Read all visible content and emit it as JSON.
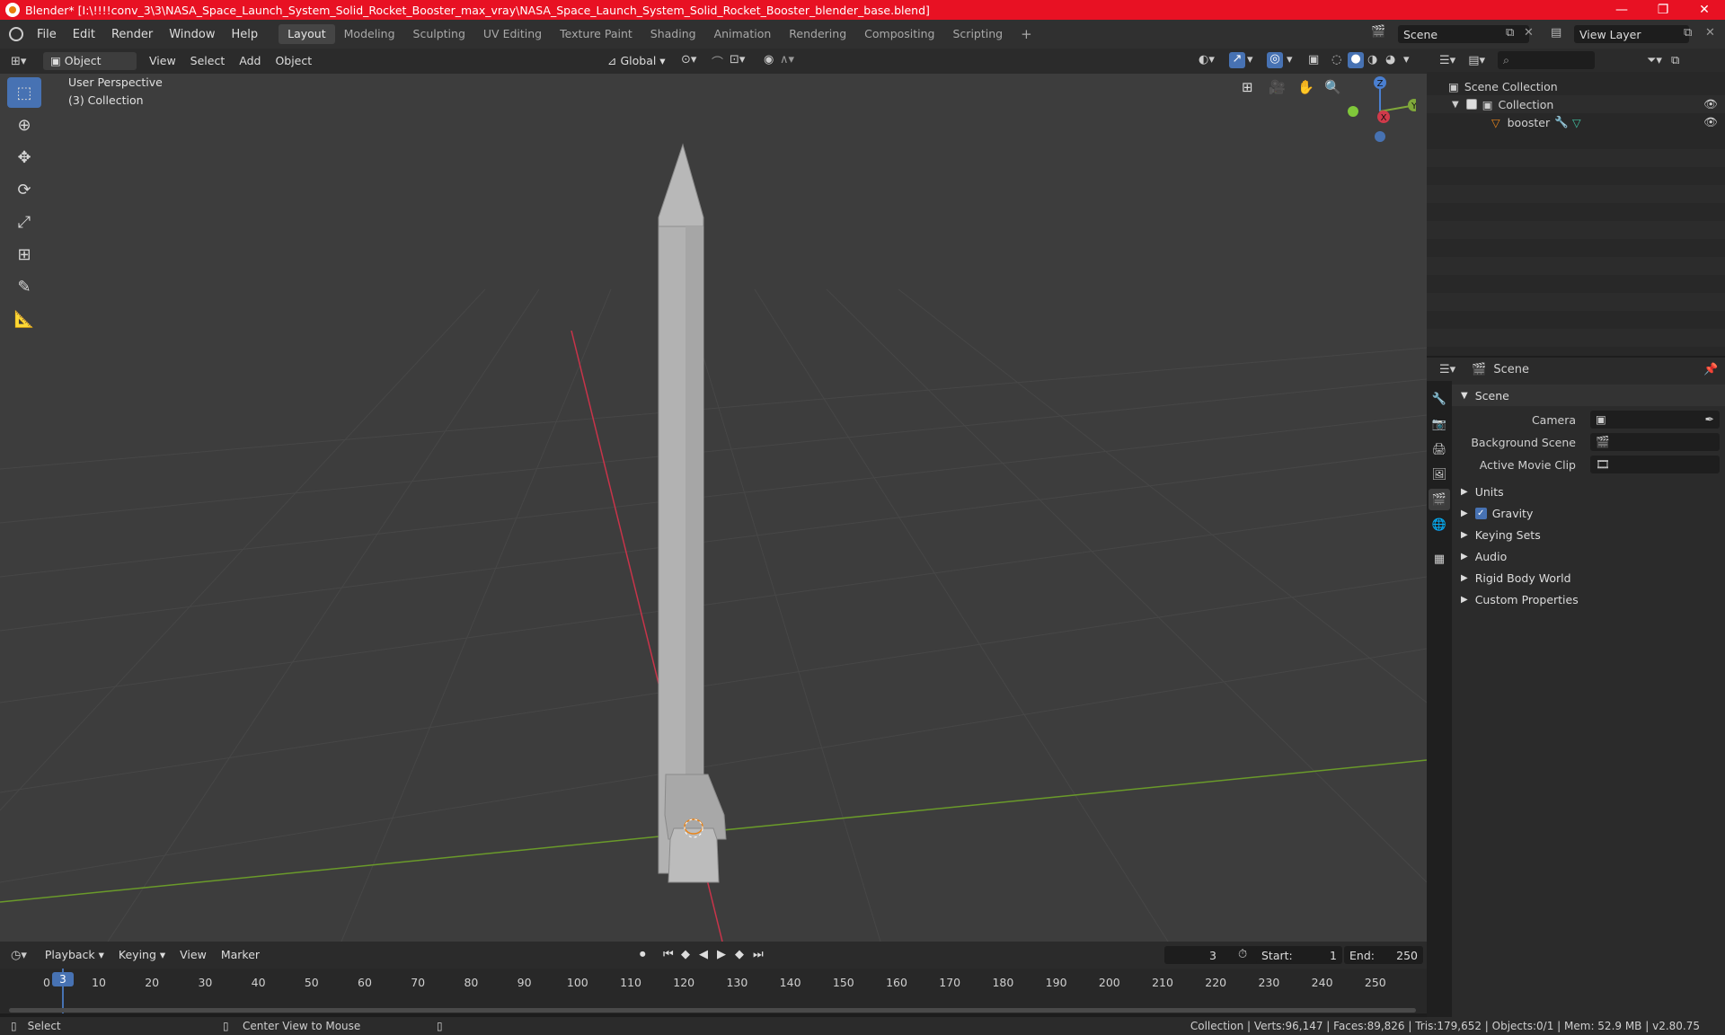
{
  "window": {
    "title": "Blender* [I:\\!!!!conv_3\\3\\NASA_Space_Launch_System_Solid_Rocket_Booster_max_vray\\NASA_Space_Launch_System_Solid_Rocket_Booster_blender_base.blend]",
    "minimize": "—",
    "maximize": "❐",
    "close": "✕"
  },
  "menu": [
    "File",
    "Edit",
    "Render",
    "Window",
    "Help"
  ],
  "workspaces": [
    "Layout",
    "Modeling",
    "Sculpting",
    "UV Editing",
    "Texture Paint",
    "Shading",
    "Animation",
    "Rendering",
    "Compositing",
    "Scripting"
  ],
  "active_workspace": "Layout",
  "add_workspace": "+",
  "scene_field": "Scene",
  "view_layer_field": "View Layer",
  "viewport_header": {
    "mode": "Object Mode",
    "menus": [
      "View",
      "Select",
      "Add",
      "Object"
    ],
    "orientation": "Global"
  },
  "viewport": {
    "perspective": "User Perspective",
    "collection": "(3) Collection",
    "gizmo_axes": {
      "z": "Z",
      "y": "Y",
      "x": "X"
    }
  },
  "outliner": {
    "items": [
      "Scene Collection",
      "Collection",
      "booster"
    ]
  },
  "properties": {
    "header_title": "Scene",
    "panel_title": "Scene",
    "fields": [
      {
        "label": "Camera"
      },
      {
        "label": "Background Scene"
      },
      {
        "label": "Active Movie Clip"
      }
    ],
    "subpanels": [
      "Units",
      "Gravity",
      "Keying Sets",
      "Audio",
      "Rigid Body World",
      "Custom Properties"
    ],
    "gravity_checked": true
  },
  "timeline": {
    "menus": [
      "Playback",
      "Keying",
      "View",
      "Marker"
    ],
    "current_frame": "3",
    "start_label": "Start:",
    "start_value": "1",
    "end_label": "End:",
    "end_value": "250",
    "ruler": [
      "0",
      "10",
      "20",
      "30",
      "40",
      "50",
      "60",
      "70",
      "80",
      "90",
      "100",
      "110",
      "120",
      "130",
      "140",
      "150",
      "160",
      "170",
      "180",
      "190",
      "200",
      "210",
      "220",
      "230",
      "240",
      "250"
    ],
    "playhead_label": "3"
  },
  "status_bar": {
    "left_action": "Select",
    "middle_action": "Center View to Mouse",
    "stats": "Collection | Verts:96,147 | Faces:89,826 | Tris:179,652 | Objects:0/1 | Mem: 52.9 MB | v2.80.75"
  },
  "colors": {
    "title_bar": "#e81123",
    "accent_blue": "#4772b3",
    "axis_red": "#c8344a",
    "axis_green": "#6a9a2a",
    "object_orange": "#e8841a"
  }
}
